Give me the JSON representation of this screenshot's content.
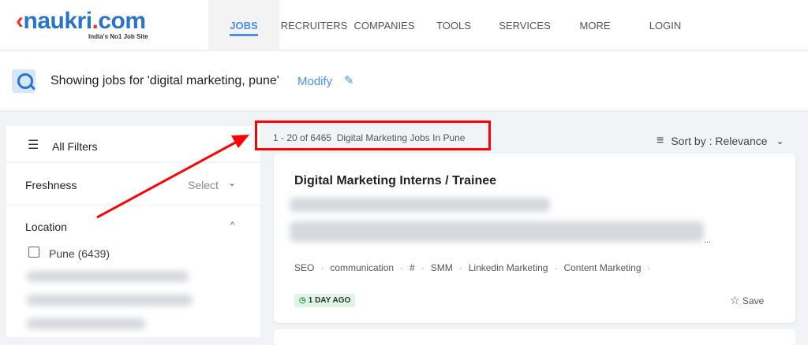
{
  "header": {
    "logo": "naukri.com",
    "logo_tagline": "India's No1 Job Site",
    "nav": [
      "JOBS",
      "RECRUITERS",
      "COMPANIES",
      "TOOLS",
      "SERVICES",
      "MORE",
      "LOGIN"
    ]
  },
  "search": {
    "text": "Showing jobs for 'digital marketing, pune'",
    "modify": "Modify"
  },
  "filters": {
    "all": "All Filters",
    "freshness": "Freshness",
    "freshness_value": "Select",
    "location": "Location",
    "pune": "Pune (6439)"
  },
  "results": {
    "count": "1 - 20 of 6465  Digital Marketing Jobs In Pune",
    "sort": "Sort by : Relevance"
  },
  "job": {
    "title": "Digital Marketing Interns / Trainee",
    "ellipsis": "...",
    "tags": [
      "SEO",
      "communication",
      "#",
      "SMM",
      "Linkedin Marketing",
      "Content Marketing"
    ],
    "posted": "1 DAY AGO",
    "save": "Save"
  },
  "colors": {
    "accent": "#4a90e2",
    "annotation": "#ff0000"
  }
}
